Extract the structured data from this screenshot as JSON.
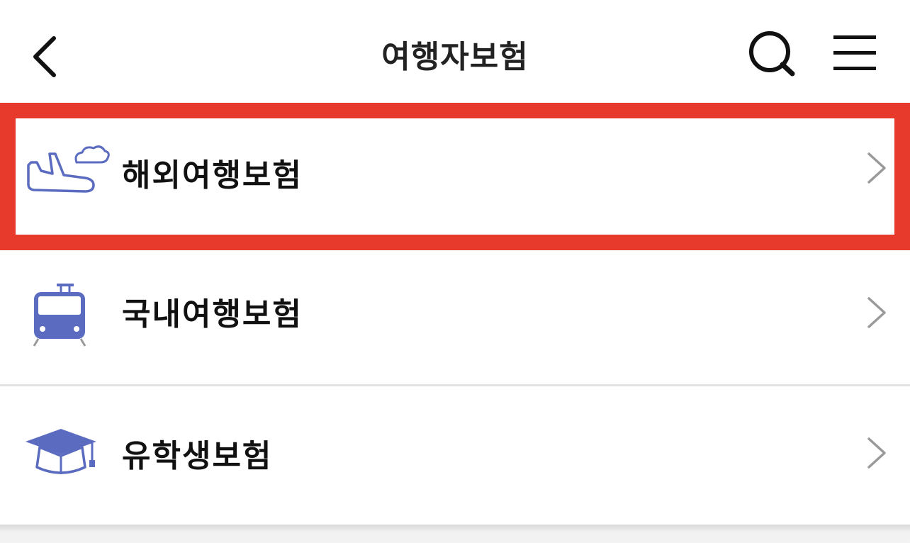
{
  "header": {
    "title": "여행자보험",
    "back_icon": "chevron-left-icon",
    "search_icon": "search-icon",
    "menu_icon": "hamburger-menu-icon"
  },
  "items": [
    {
      "label": "해외여행보험",
      "icon": "airplane-icon",
      "highlighted": true
    },
    {
      "label": "국내여행보험",
      "icon": "train-icon",
      "highlighted": false
    },
    {
      "label": "유학생보험",
      "icon": "graduation-cap-icon",
      "highlighted": false
    }
  ],
  "colors": {
    "highlight": "#e8392d",
    "icon": "#5b6cc0",
    "chevron": "#9a9a9a"
  }
}
